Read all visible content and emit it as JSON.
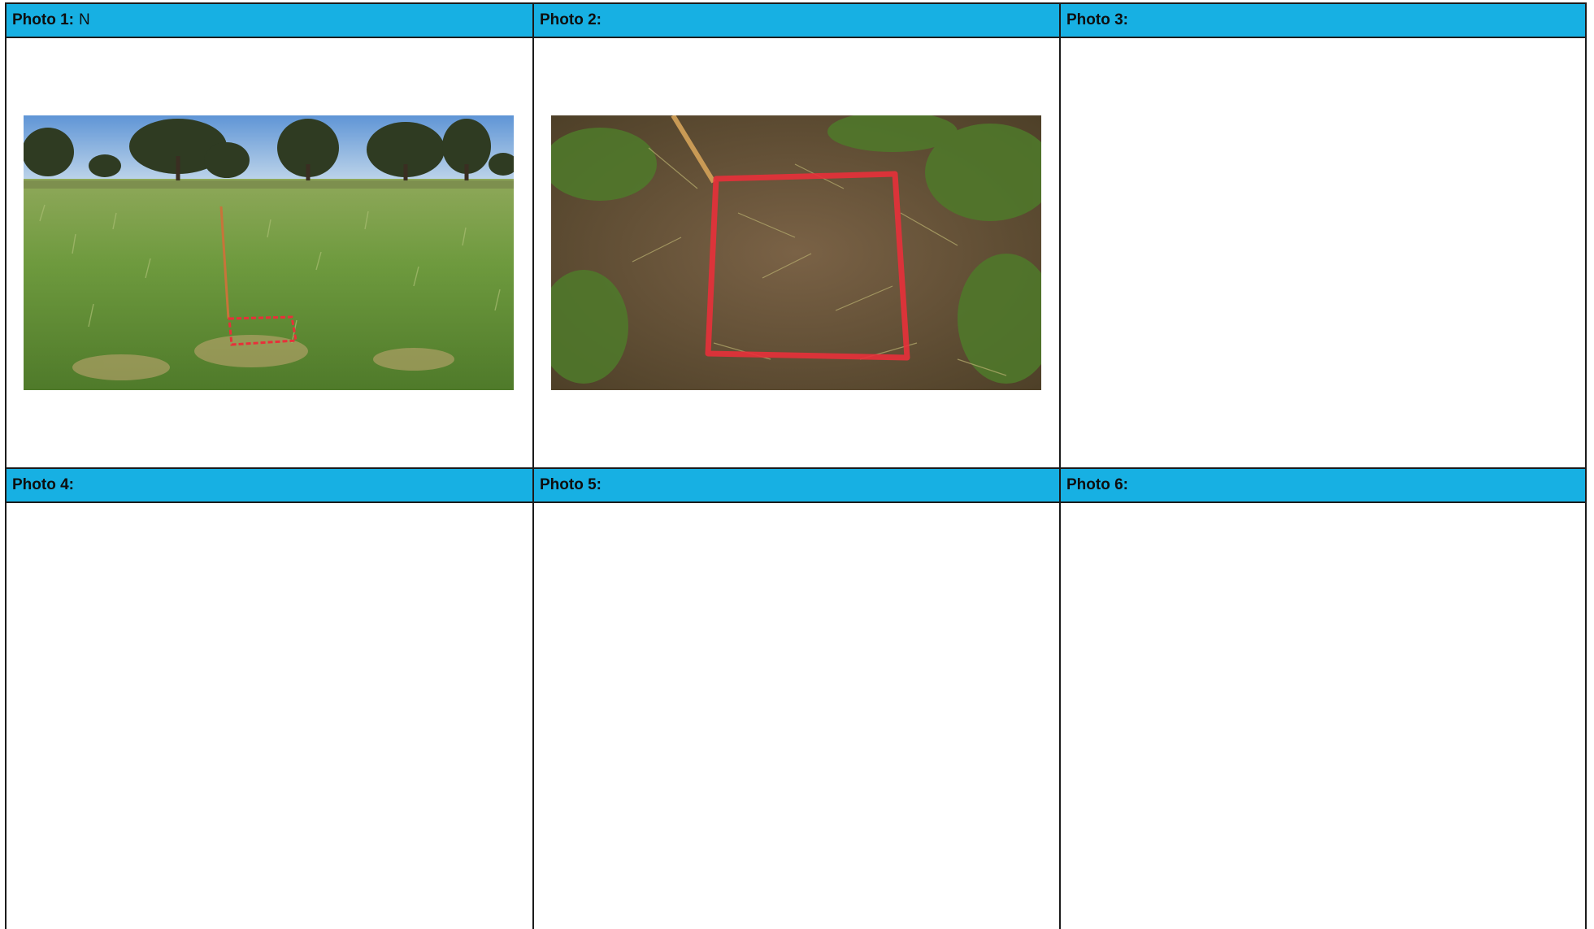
{
  "rows": [
    [
      {
        "label": "Photo 1:",
        "value": "N",
        "photo": "pasture-landscape-with-stake"
      },
      {
        "label": "Photo 2:",
        "value": "",
        "photo": "quadrat-close-up"
      },
      {
        "label": "Photo 3:",
        "value": ""
      }
    ],
    [
      {
        "label": "Photo 4:",
        "value": ""
      },
      {
        "label": "Photo 5:",
        "value": ""
      },
      {
        "label": "Photo 6:",
        "value": ""
      }
    ]
  ],
  "colors": {
    "header": "#17b0e3",
    "border": "#1b1b1b",
    "marker_paint": "#e8303a"
  }
}
